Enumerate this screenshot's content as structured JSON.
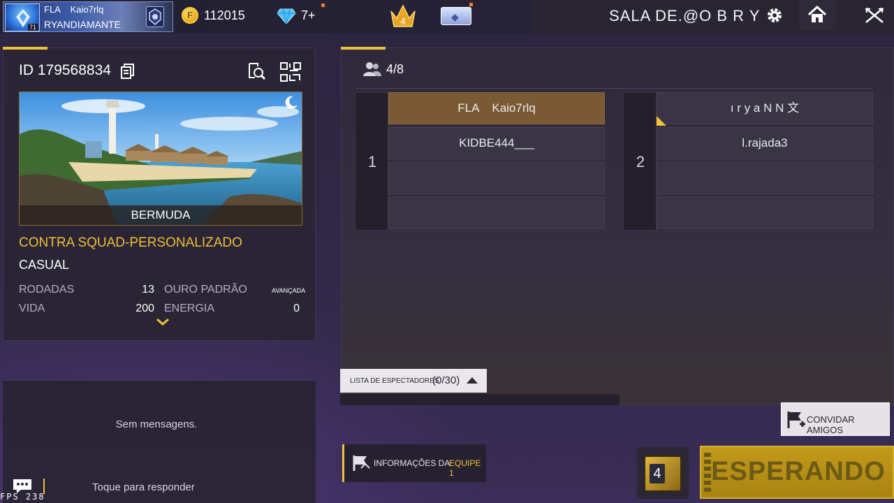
{
  "topbar": {
    "player_name": "FLA    Kaio7rlq",
    "player_rank": "RYANDIAMANTE",
    "player_level": "71",
    "coins": "112015",
    "diamonds": "7+",
    "rank_tier": "4",
    "room_title": "SALA DE.@O B R Y"
  },
  "room": {
    "id": "ID 179568834",
    "map": "BERMUDA",
    "mode": "CONTRA SQUAD-PERSONALIZADO",
    "mode_type": "CASUAL",
    "stats": {
      "rounds_label": "RODADAS",
      "rounds_value": "13",
      "gold_label": "OURO PADRÃO",
      "gold_value": "AVANÇADA",
      "hp_label": "VIDA",
      "hp_value": "200",
      "energy_label": "ENERGIA",
      "energy_value": "0"
    }
  },
  "chat": {
    "empty": "Sem mensagens.",
    "reply": "Toque para responder",
    "fps": "FPS 238"
  },
  "lobby": {
    "player_count": "4/8",
    "team1": {
      "number": "1",
      "slots": [
        "FLA    Kaio7rlq",
        "KIDBE444___",
        "",
        ""
      ]
    },
    "team2": {
      "number": "2",
      "slots": [
        "ı r y a N N 文",
        "l.rajada3",
        "",
        ""
      ]
    },
    "spectators_label": "LISTA DE ESPECTADORES",
    "spectators_count": "(0/30)",
    "invite_label": "CONVIDAR AMIGOS",
    "team_info_label": "INFORMAÇÕES DA",
    "team_info_team": "EQUIPE 1",
    "dice_number": "4",
    "status_button": "ESPERANDO"
  },
  "colors": {
    "accent": "#f0c23a",
    "leader_slot": "#7a5a34",
    "background": "#2f2844"
  }
}
